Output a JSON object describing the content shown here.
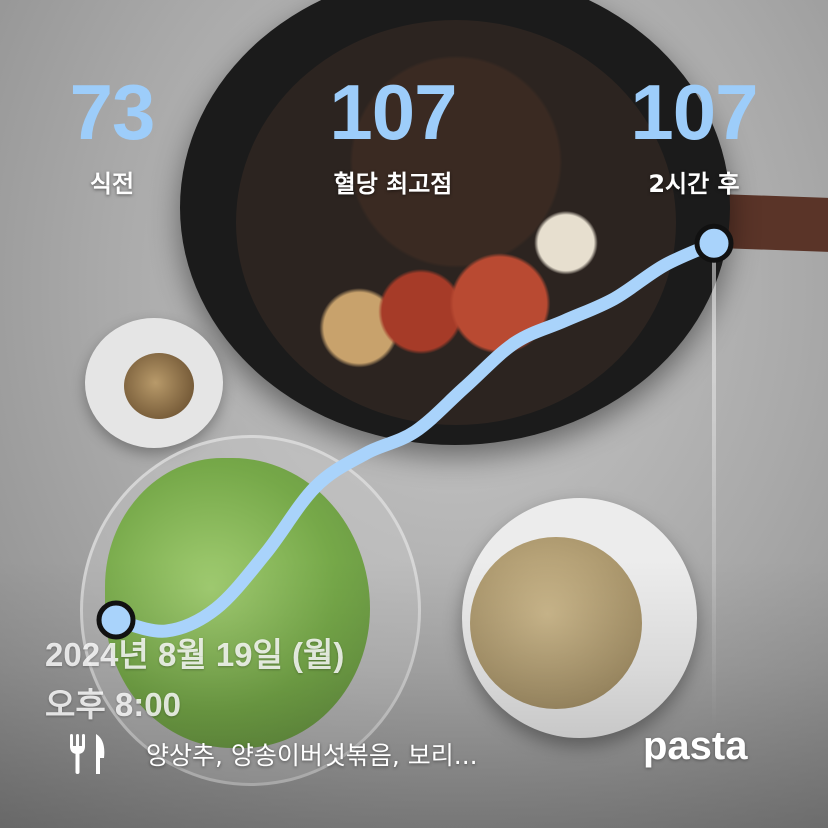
{
  "stats": {
    "pre_meal": {
      "value": "73",
      "label": "식전"
    },
    "peak": {
      "value": "107",
      "label": "혈당 최고점"
    },
    "after_2h": {
      "value": "107",
      "label": "2시간 후"
    }
  },
  "meal": {
    "date": "2024년 8월 19일 (월)",
    "time": "오후 8:00",
    "foods": "양상추, 양송이버섯볶음, 보리..."
  },
  "brand": "pasta",
  "colors": {
    "accent": "#9dcdfa",
    "curve": "#a9d3fb",
    "marker_outline": "#111111"
  },
  "icons": {
    "meal": "fork-knife-icon"
  },
  "chart_data": {
    "type": "line",
    "series": [
      {
        "x": [
          0,
          10,
          20,
          30,
          40,
          50,
          60,
          70,
          80,
          90,
          100,
          110,
          120
        ],
        "values": [
          73,
          72,
          74,
          79,
          85,
          88,
          90,
          94,
          98,
          100,
          102,
          105,
          107
        ]
      }
    ],
    "ylim": [
      60,
      110
    ],
    "xlim": [
      0,
      120
    ],
    "markers": [
      {
        "x": 0,
        "y": 73
      },
      {
        "x": 120,
        "y": 107
      }
    ],
    "grid": false
  }
}
